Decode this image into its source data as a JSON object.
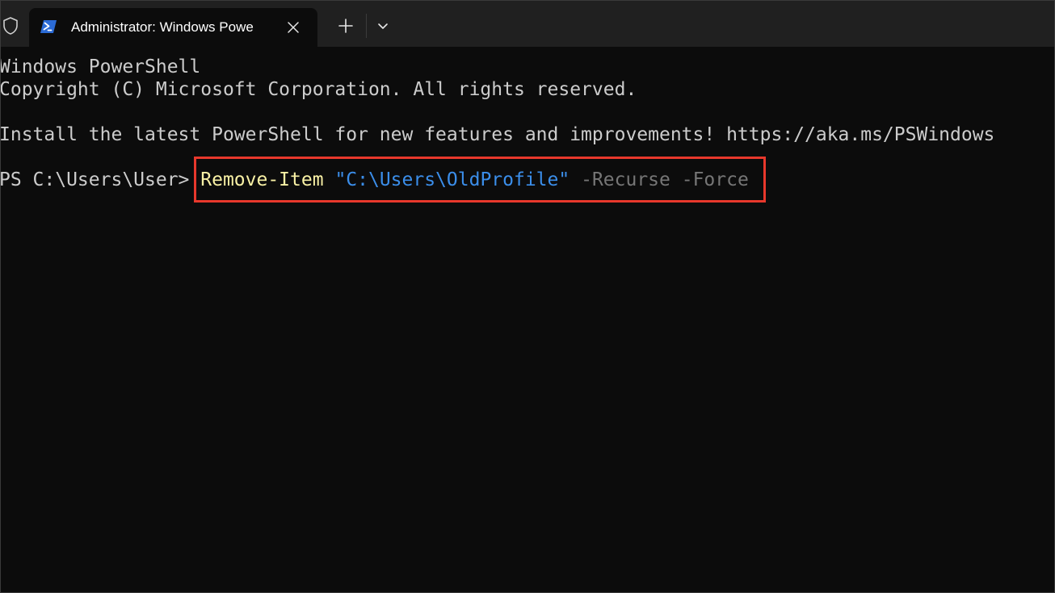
{
  "window": {
    "tab": {
      "title": "Administrator: Windows Powe",
      "icon": "powershell-icon"
    },
    "icons": {
      "shield": "shield-icon",
      "close": "close-icon",
      "new_tab": "plus-icon",
      "dropdown": "chevron-down-icon"
    }
  },
  "terminal": {
    "lines": [
      "Windows PowerShell",
      "Copyright (C) Microsoft Corporation. All rights reserved.",
      "Install the latest PowerShell for new features and improvements! https://aka.ms/PSWindows"
    ],
    "prompt": "PS C:\\Users\\User> ",
    "command": {
      "name": "Remove-Item",
      "argument": "\"C:\\Users\\OldProfile\"",
      "parameters": "-Recurse -Force"
    }
  },
  "colors": {
    "background": "#0c0c0c",
    "titlebar": "#202020",
    "text": "#cccccc",
    "command_name": "#f9f1a5",
    "command_argument": "#3b8eea",
    "command_parameter": "#767676",
    "highlight_box": "#e8382c"
  }
}
